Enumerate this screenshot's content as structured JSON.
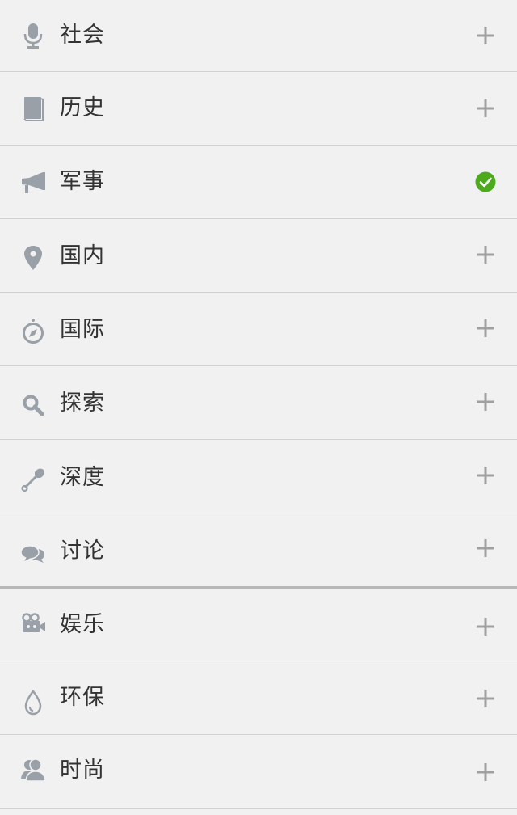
{
  "categories": [
    {
      "label": "社会",
      "icon": "microphone-icon",
      "subscribed": false
    },
    {
      "label": "历史",
      "icon": "book-icon",
      "subscribed": false
    },
    {
      "label": "军事",
      "icon": "megaphone-icon",
      "subscribed": true
    },
    {
      "label": "国内",
      "icon": "location-pin-icon",
      "subscribed": false
    },
    {
      "label": "国际",
      "icon": "compass-icon",
      "subscribed": false
    },
    {
      "label": "探索",
      "icon": "magnifier-icon",
      "subscribed": false
    },
    {
      "label": "深度",
      "icon": "shovel-icon",
      "subscribed": false
    },
    {
      "label": "讨论",
      "icon": "chat-bubbles-icon",
      "subscribed": false
    },
    {
      "label": "娱乐",
      "icon": "video-camera-icon",
      "subscribed": false
    },
    {
      "label": "环保",
      "icon": "water-drop-icon",
      "subscribed": false
    },
    {
      "label": "时尚",
      "icon": "people-icon",
      "subscribed": false
    }
  ],
  "colors": {
    "icon": "#9aa0a8",
    "text": "#333333",
    "add": "#a0a0a0",
    "subscribed": "#4caa1c",
    "background": "#f1f1f1"
  }
}
